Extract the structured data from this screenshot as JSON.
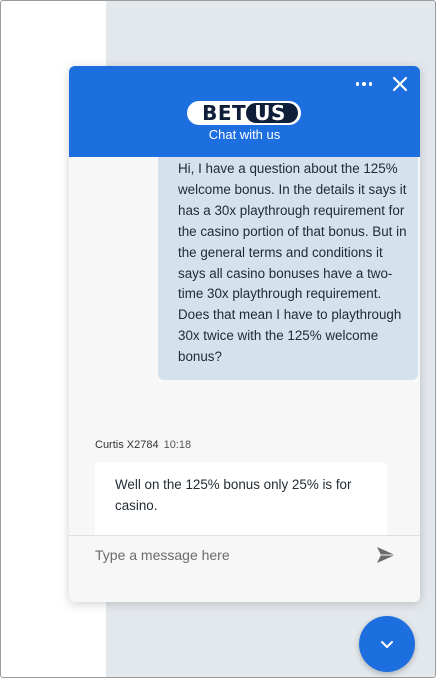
{
  "header": {
    "logo_part1": "BET",
    "logo_part2": "US",
    "subtitle": "Chat with us",
    "more_icon": "more-horizontal-icon",
    "close_icon": "close-icon"
  },
  "messages": {
    "user_message": "Hi, I have a question about the 125% welcome bonus. In the details it says it has a 30x playthrough requirement for the casino portion of that bonus. But in the general terms and conditions it says all casino bonuses have a two-time 30x playthrough requirement. Does that mean I have to playthrough 30x twice with the 125% welcome bonus?",
    "agent_name": "Curtis X2784",
    "agent_time": "10:18",
    "agent_message": "Well on the 125% bonus only 25% is for casino."
  },
  "composer": {
    "placeholder": "Type a message here",
    "send_icon": "send-icon"
  },
  "colors": {
    "brand_blue": "#1d6fe0",
    "user_bubble": "#d5e1ec",
    "logo_dark": "#0f1f3a"
  }
}
